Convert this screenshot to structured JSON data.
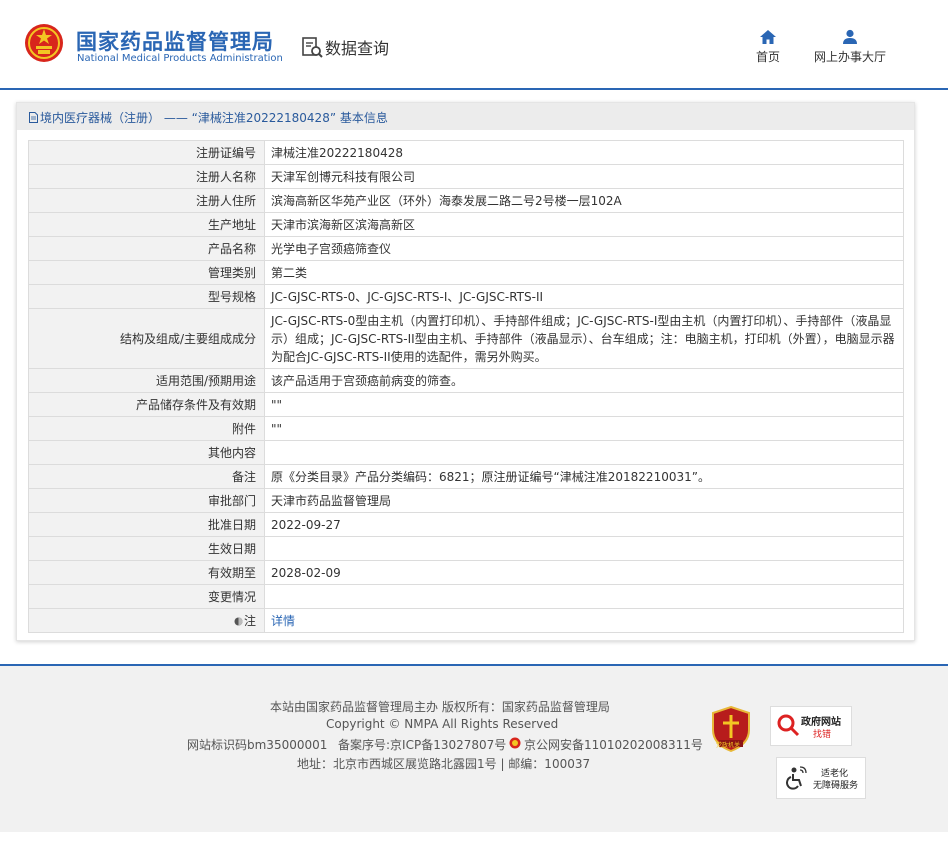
{
  "header": {
    "org_name_cn": "国家药品监督管理局",
    "org_name_en": "National Medical Products Administration",
    "query_label": "数据查询",
    "nav": [
      {
        "label": "首页",
        "icon": "home-icon"
      },
      {
        "label": "网上办事大厅",
        "icon": "user-icon"
      }
    ]
  },
  "panel": {
    "title": "境内医疗器械（注册） —— “津械注准20222180428” 基本信息"
  },
  "rows": [
    {
      "label": "注册证编号",
      "value": "津械注准20222180428"
    },
    {
      "label": "注册人名称",
      "value": "天津军创博元科技有限公司"
    },
    {
      "label": "注册人住所",
      "value": "滨海高新区华苑产业区（环外）海泰发展二路二号2号楼一层102A"
    },
    {
      "label": "生产地址",
      "value": "天津市滨海新区滨海高新区"
    },
    {
      "label": "产品名称",
      "value": "光学电子宫颈癌筛查仪"
    },
    {
      "label": "管理类别",
      "value": "第二类"
    },
    {
      "label": "型号规格",
      "value": "JC-GJSC-RTS-0、JC-GJSC-RTS-I、JC-GJSC-RTS-II"
    },
    {
      "label": "结构及组成/主要组成成分",
      "value": "JC-GJSC-RTS-0型由主机（内置打印机）、手持部件组成；JC-GJSC-RTS-I型由主机（内置打印机）、手持部件（液晶显示）组成；JC-GJSC-RTS-II型由主机、手持部件（液晶显示）、台车组成；注：电脑主机，打印机（外置），电脑显示器为配合JC-GJSC-RTS-II使用的选配件，需另外购买。"
    },
    {
      "label": "适用范围/预期用途",
      "value": "该产品适用于宫颈癌前病变的筛查。"
    },
    {
      "label": "产品储存条件及有效期",
      "value": "\"\""
    },
    {
      "label": "附件",
      "value": "\"\""
    },
    {
      "label": "其他内容",
      "value": ""
    },
    {
      "label": "备注",
      "value": "原《分类目录》产品分类编码：6821；原注册证编号“津械注准20182210031”。"
    },
    {
      "label": "审批部门",
      "value": "天津市药品监督管理局"
    },
    {
      "label": "批准日期",
      "value": "2022-09-27"
    },
    {
      "label": "生效日期",
      "value": ""
    },
    {
      "label": "有效期至",
      "value": "2028-02-09"
    },
    {
      "label": "变更情况",
      "value": ""
    },
    {
      "label": "注",
      "value": "详情"
    }
  ],
  "footer": {
    "line1": "本站由国家药品监督管理局主办 版权所有：国家药品监督管理局",
    "line2": "Copyright © NMPA All Rights Reserved",
    "site_id": "网站标识码bm35000001",
    "icp": "备案序号:京ICP备13027807号",
    "police": "京公网安备11010202008311号",
    "address": "地址：北京市西城区展览路北露园1号 | 邮编：100037",
    "badge_shield": "党政机关",
    "badge_gov_1": "政府网站",
    "badge_gov_2": "找错",
    "badge_acc_1": "适老化",
    "badge_acc_2": "无障碍服务"
  },
  "colors": {
    "brand_blue": "#2a66b4",
    "emblem_red": "#d8261c",
    "emblem_gold": "#f3c623"
  }
}
